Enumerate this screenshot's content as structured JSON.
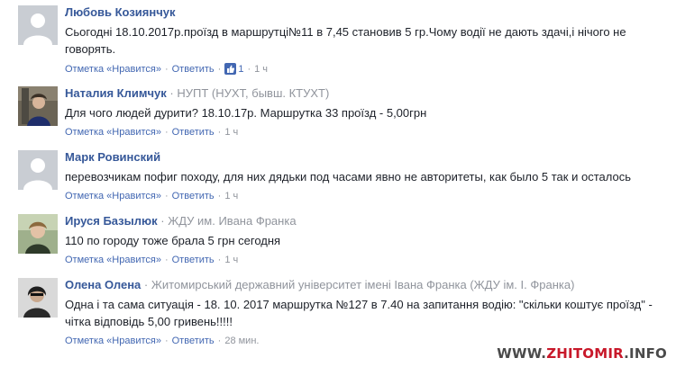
{
  "comments": [
    {
      "author": "Любовь Козиянчук",
      "affiliation": "",
      "text_line1": "Сьогодні 18.10.2017р.проїзд в маршрутці№11 в 7,45 становив 5 гр.Чому водії не дають здачі,і нічого не",
      "text_line2": "говорять.",
      "reply_label": "Отметка «Нравится»",
      "answer_label": "Ответить",
      "likes": "1",
      "time": "1 ч",
      "avatar": "default-avatar-icon"
    },
    {
      "author": "Наталия Климчук",
      "affiliation": "НУПТ (НУХТ, бывш. КТУХТ)",
      "text_line1": "Для чого людей дурити? 18.10.17р. Маршрутка 33 проїзд - 5,00грн",
      "text_line2": "",
      "reply_label": "Отметка «Нравится»",
      "answer_label": "Ответить",
      "likes": "",
      "time": "1 ч",
      "avatar": "photo-avatar"
    },
    {
      "author": "Марк Ровинский",
      "affiliation": "",
      "text_line1": "перевозчикам пофиг походу, для них дядьки под часами явно не авторитеты, как было 5 так и осталось",
      "text_line2": "",
      "reply_label": "Отметка «Нравится»",
      "answer_label": "Ответить",
      "likes": "",
      "time": "1 ч",
      "avatar": "default-avatar-icon"
    },
    {
      "author": "Ируся Базылюк",
      "affiliation": "ЖДУ им. Ивана Франка",
      "text_line1": "110 по городу тоже брала 5 грн сегодня",
      "text_line2": "",
      "reply_label": "Отметка «Нравится»",
      "answer_label": "Ответить",
      "likes": "",
      "time": "1 ч",
      "avatar": "photo-avatar"
    },
    {
      "author": "Олена Олена",
      "affiliation": "Житомирський державний університет імені Івана Франка (ЖДУ ім. І. Франка)",
      "text_line1": "Одна і та сама ситуація - 18. 10. 2017 маршрутка №127 в 7.40 на запитання водію: \"скільки коштує проїзд\" -",
      "text_line2": "чітка відповідь 5,00 гривень!!!!!",
      "reply_label": "Отметка «Нравится»",
      "answer_label": "Ответить",
      "likes": "",
      "time": "28 мин.",
      "avatar": "photo-avatar"
    }
  ],
  "separator": "·",
  "watermark": {
    "prefix": "WWW.",
    "main": "ZHITOMIR",
    "suffix": ".INFO"
  },
  "colors": {
    "author": "#365899",
    "link": "#4267b2",
    "meta": "#90949c",
    "text": "#1d2129",
    "watermark_red": "#c8182a"
  }
}
